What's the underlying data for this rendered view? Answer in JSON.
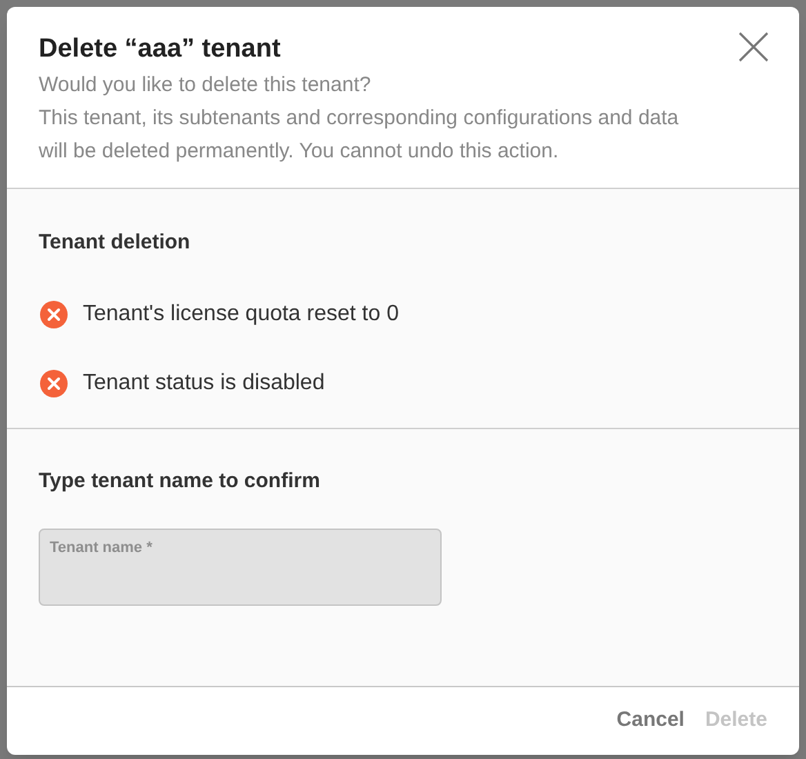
{
  "dialog": {
    "title": "Delete “aaa” tenant",
    "subtitle": "Would you like to delete this tenant?",
    "description": "This tenant, its subtenants and corresponding configurations and data will be deleted permanently. You cannot undo this action."
  },
  "deletion": {
    "heading": "Tenant deletion",
    "items": [
      {
        "text": "Tenant's license quota reset to 0",
        "kind": "error"
      },
      {
        "text": "Tenant status is disabled",
        "kind": "error"
      }
    ]
  },
  "confirm": {
    "heading": "Type tenant name to confirm",
    "field": {
      "placeholder": "Tenant name *",
      "disabled": true
    }
  },
  "buttons": [
    {
      "label": "Cancel",
      "disabled": false
    },
    {
      "label": "Delete",
      "disabled": true
    }
  ]
}
